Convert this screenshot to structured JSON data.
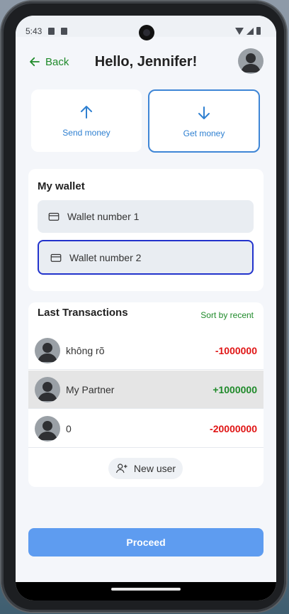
{
  "status_bar": {
    "time": "5:43"
  },
  "header": {
    "back_label": "Back",
    "title": "Hello, Jennifer!"
  },
  "actions": {
    "send_label": "Send money",
    "get_label": "Get money"
  },
  "wallet": {
    "title": "My wallet",
    "items": [
      {
        "label": "Wallet number 1",
        "selected": false
      },
      {
        "label": "Wallet number 2",
        "selected": true
      }
    ]
  },
  "transactions": {
    "title": "Last Transactions",
    "sort_label": "Sort by recent",
    "rows": [
      {
        "name": "không rõ",
        "amount": "-1000000",
        "type": "negative"
      },
      {
        "name": "My Partner",
        "amount": "+1000000",
        "type": "positive"
      },
      {
        "name": "0",
        "amount": "-20000000",
        "type": "negative"
      }
    ],
    "new_user_label": "New user"
  },
  "footer": {
    "proceed_label": "Proceed"
  },
  "colors": {
    "accent_green": "#1f8a2a",
    "accent_blue": "#2f80d1",
    "negative": "#e01515",
    "button": "#5e9cf0"
  }
}
